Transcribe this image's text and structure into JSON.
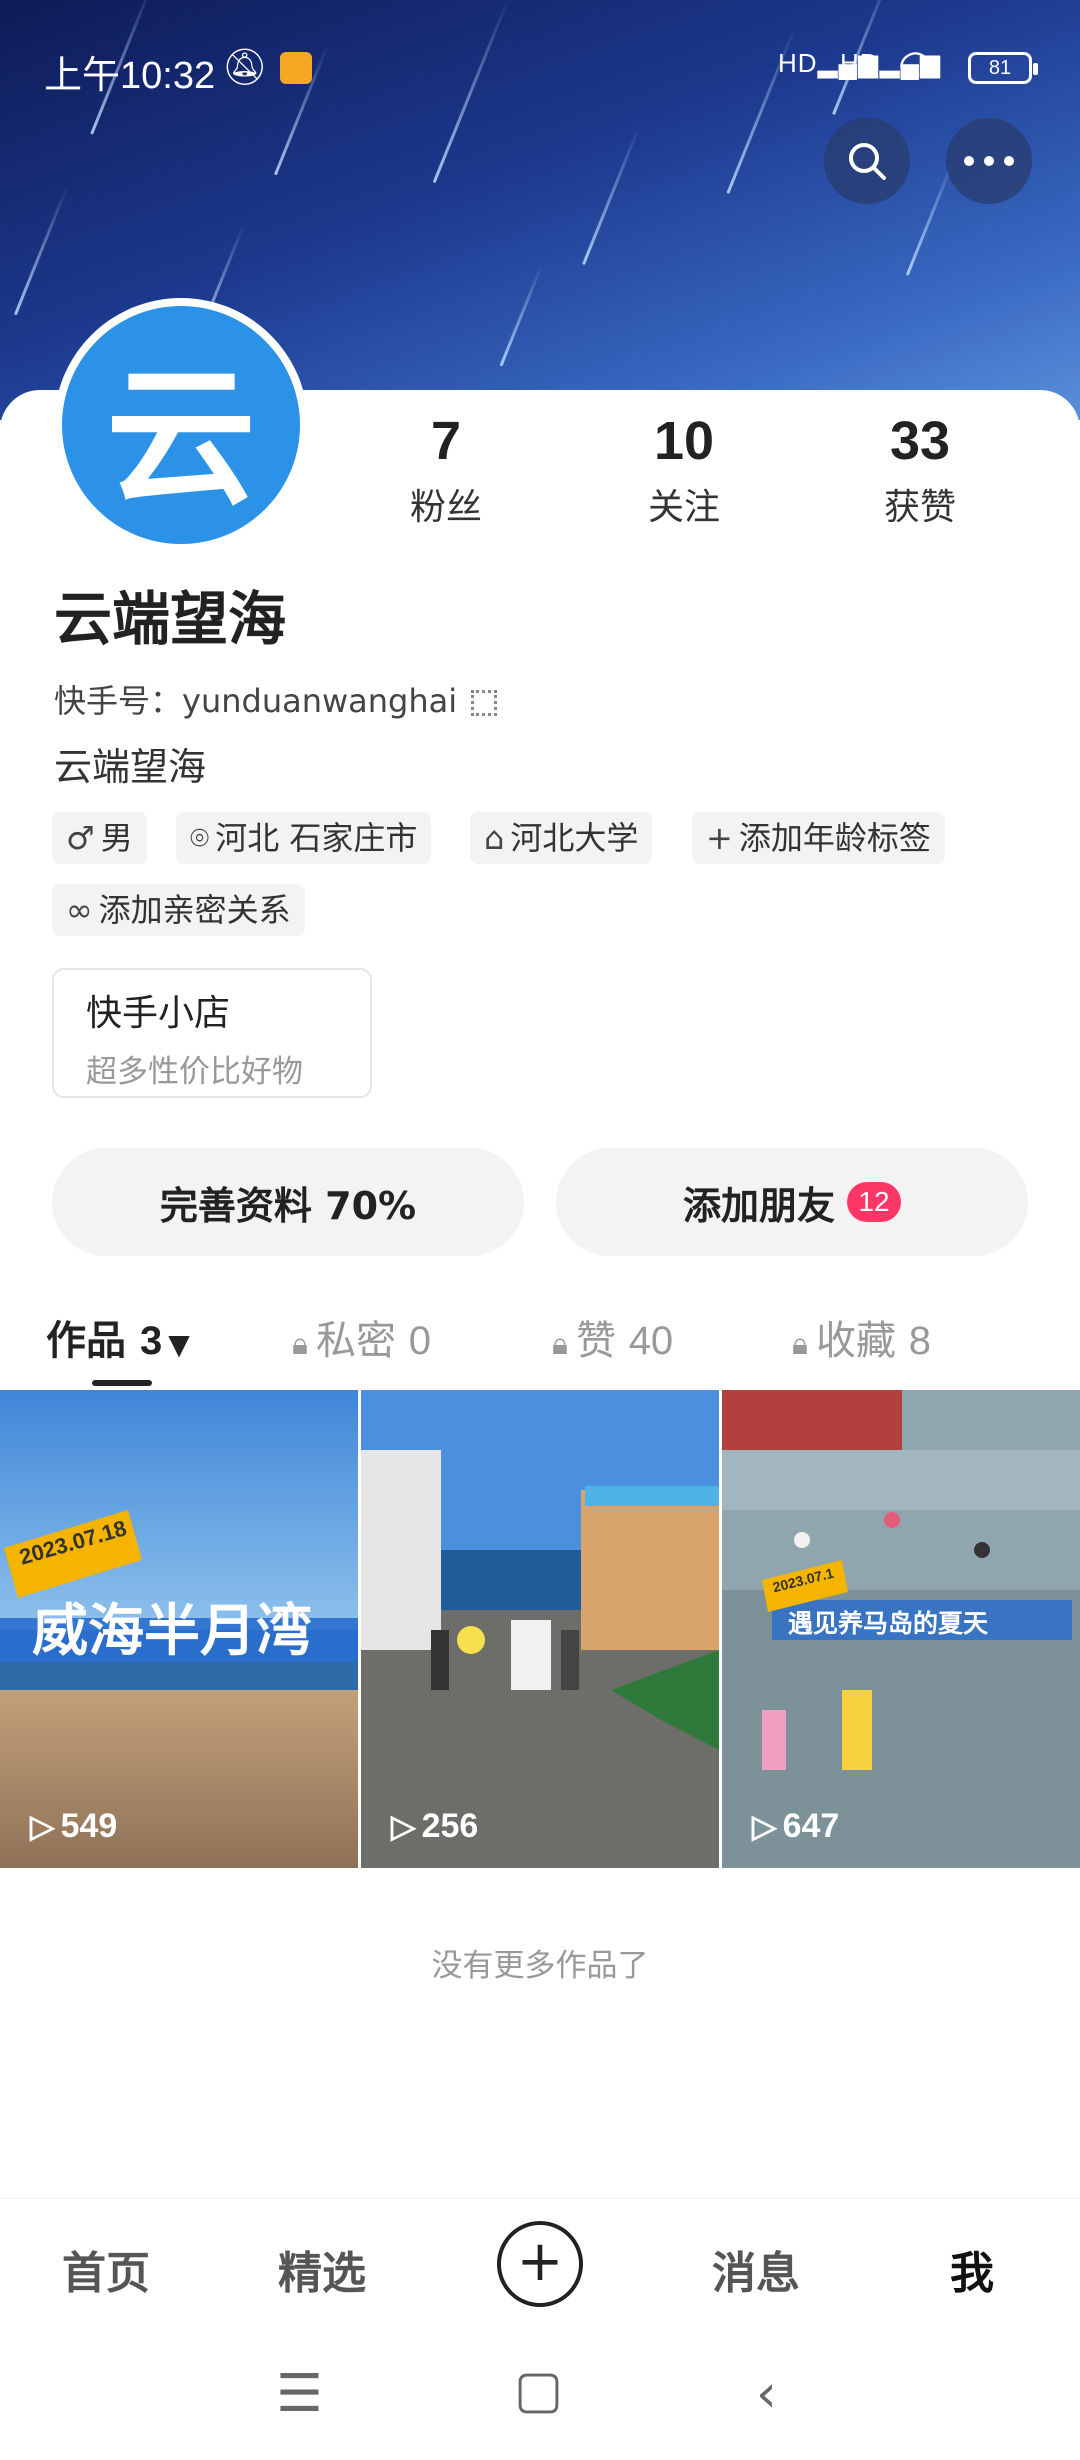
{
  "status_bar": {
    "time": "上午10:32",
    "signal_1": "HD",
    "signal_2": "HD",
    "battery": "81"
  },
  "header": {
    "search_icon": "search-icon",
    "more_icon": "more-icon"
  },
  "profile": {
    "avatar_char": "云",
    "nickname": "云端望海",
    "kuaishou_id_label": "快手号：yunduanwanghai",
    "bio": "云端望海",
    "stats": [
      {
        "num": "7",
        "label": "粉丝"
      },
      {
        "num": "10",
        "label": "关注"
      },
      {
        "num": "33",
        "label": "获赞"
      }
    ],
    "tags": [
      {
        "icon": "♂",
        "text": "男"
      },
      {
        "icon": "⌾",
        "text": "河北 石家庄市"
      },
      {
        "icon": "⌂",
        "text": "河北大学"
      },
      {
        "icon": "+",
        "text": "添加年龄标签"
      },
      {
        "icon": "∞",
        "text": "添加亲密关系"
      }
    ]
  },
  "shop": {
    "title": "快手小店",
    "subtitle": "超多性价比好物"
  },
  "actions": {
    "complete_profile": "完善资料 70%",
    "add_friends": "添加朋友",
    "add_friends_badge": "12"
  },
  "tabs": [
    {
      "label": "作品",
      "count": "3"
    },
    {
      "label": "私密",
      "count": "0"
    },
    {
      "label": "赞",
      "count": "40"
    },
    {
      "label": "收藏",
      "count": "8"
    }
  ],
  "videos": [
    {
      "date": "2023.07.18",
      "title": "威海半月湾",
      "plays": "549"
    },
    {
      "plays": "256"
    },
    {
      "date": "2023.07.1",
      "title": "遇见养马岛的夏天",
      "plays": "647"
    }
  ],
  "no_more": "没有更多作品了",
  "bottom_nav": {
    "home": "首页",
    "featured": "精选",
    "messages": "消息",
    "me": "我"
  },
  "colors": {
    "accent_badge": "#fe3666",
    "avatar_blue": "#2c92e8"
  }
}
